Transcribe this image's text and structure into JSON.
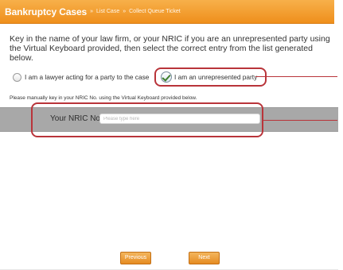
{
  "header": {
    "title": "Bankruptcy Cases",
    "breadcrumb": {
      "separator_1": "»",
      "item_1": "List Case",
      "separator_2": "»",
      "item_2": "Collect Queue Ticket"
    }
  },
  "instructions": "Key in the name of your law firm, or your NRIC if you are an unrepresented party using the Virtual Keyboard provided, then select the correct entry from the list generated below.",
  "options": [
    {
      "label": "I am a lawyer acting for a party to the case",
      "selected": false
    },
    {
      "label": "I am an unrepresented party",
      "selected": true
    }
  ],
  "note": "Please manually key in your NRIC No. using the Virtual Keyboard provided below.",
  "nric": {
    "label": "Your NRIC No.",
    "placeholder": "Please type here",
    "value": ""
  },
  "buttons": {
    "previous": "Previous",
    "next": "Next"
  },
  "colors": {
    "header": "#ef8f1c",
    "accent": "#b9343a",
    "band": "#a8a8a8"
  },
  "icons": {
    "radio_unselected": "radio-circle-icon",
    "radio_selected": "checkmark-radio-icon"
  }
}
